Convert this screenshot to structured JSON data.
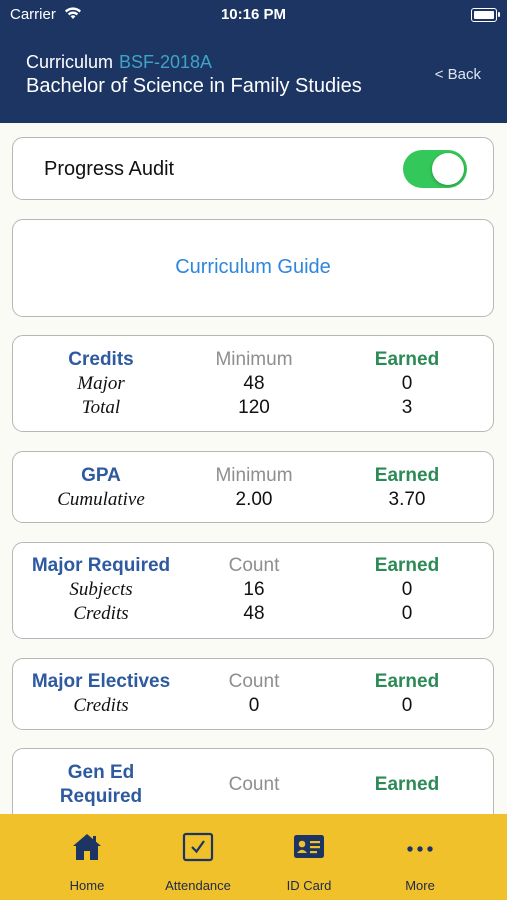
{
  "status_bar": {
    "carrier": "Carrier",
    "time": "10:16 PM"
  },
  "header": {
    "curriculum_label": "Curriculum",
    "curriculum_code": "BSF-2018A",
    "program_name": "Bachelor of Science in Family Studies",
    "back_label": "< Back"
  },
  "progress_audit": {
    "label": "Progress Audit",
    "enabled": true
  },
  "curriculum_guide": {
    "label": "Curriculum Guide"
  },
  "credits": {
    "title": "Credits",
    "col2": "Minimum",
    "col3": "Earned",
    "rows": [
      {
        "label": "Major",
        "min": "48",
        "earned": "0"
      },
      {
        "label": "Total",
        "min": "120",
        "earned": "3"
      }
    ]
  },
  "gpa": {
    "title": "GPA",
    "col2": "Minimum",
    "col3": "Earned",
    "rows": [
      {
        "label": "Cumulative",
        "min": "2.00",
        "earned": "3.70"
      }
    ]
  },
  "major_required": {
    "title": "Major Required",
    "col2": "Count",
    "col3": "Earned",
    "rows": [
      {
        "label": "Subjects",
        "count": "16",
        "earned": "0"
      },
      {
        "label": "Credits",
        "count": "48",
        "earned": "0"
      }
    ]
  },
  "major_electives": {
    "title": "Major Electives",
    "col2": "Count",
    "col3": "Earned",
    "rows": [
      {
        "label": "Credits",
        "count": "0",
        "earned": "0"
      }
    ]
  },
  "gen_ed": {
    "title_line1": "Gen Ed",
    "title_line2": "Required",
    "col2": "Count",
    "col3": "Earned"
  },
  "tabs": [
    {
      "label": "Home",
      "icon": "home-icon"
    },
    {
      "label": "Attendance",
      "icon": "checkbox-icon"
    },
    {
      "label": "ID Card",
      "icon": "id-card-icon"
    },
    {
      "label": "More",
      "icon": "more-icon"
    }
  ],
  "colors": {
    "header_bg": "#1c3563",
    "tabbar_bg": "#f1c12b",
    "toggle_on": "#34c759",
    "link": "#2f86db",
    "earned_green": "#2c8a56",
    "title_blue": "#2e5aa0"
  }
}
